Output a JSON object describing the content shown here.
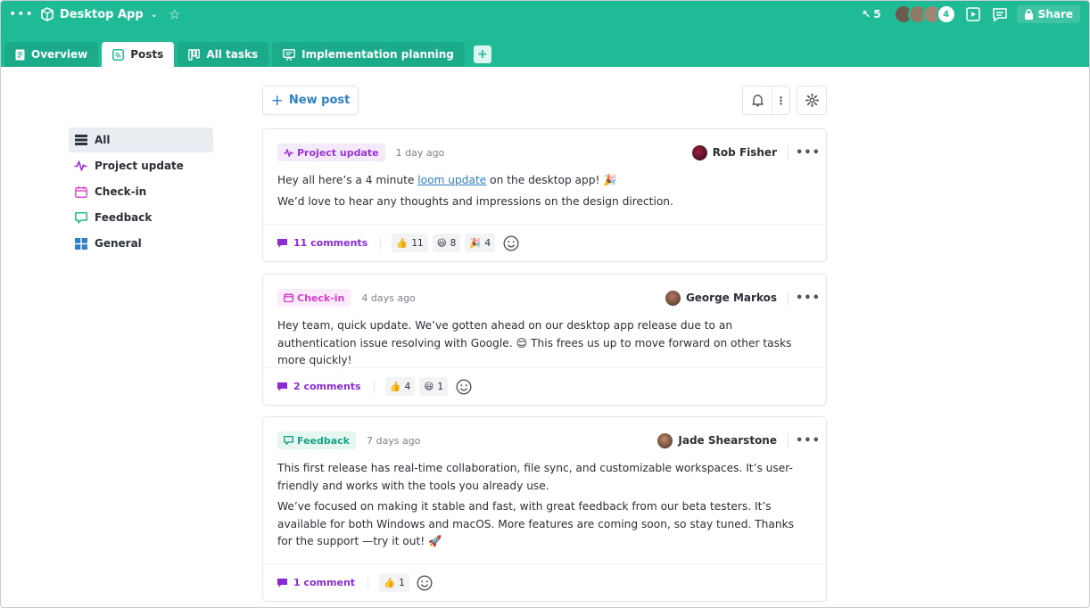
{
  "app": {
    "title": "Desktop App",
    "cursor_count": "5",
    "extra_members": "4",
    "share_label": "Share",
    "accent": "#1fba96"
  },
  "tabs": [
    {
      "label": "Overview",
      "icon": "document-icon"
    },
    {
      "label": "Posts",
      "icon": "feed-icon",
      "active": true
    },
    {
      "label": "All tasks",
      "icon": "kanban-icon"
    },
    {
      "label": "Implementation planning",
      "icon": "whiteboard-icon"
    }
  ],
  "sidebar": {
    "items": [
      {
        "label": "All",
        "icon": "list-icon",
        "color": "#2b3340",
        "active": true
      },
      {
        "label": "Project update",
        "icon": "activity-icon",
        "color": "#9b35d6"
      },
      {
        "label": "Check-in",
        "icon": "calendar-icon",
        "color": "#e04bd3"
      },
      {
        "label": "Feedback",
        "icon": "chat-icon",
        "color": "#1fba96"
      },
      {
        "label": "General",
        "icon": "grid-icon",
        "color": "#2f80c6"
      }
    ]
  },
  "toolbar": {
    "new_post_label": "New post"
  },
  "posts": [
    {
      "type": "Project update",
      "type_color": "#9b35d6",
      "type_bg": "#f5eafc",
      "time": "1 day ago",
      "author": "Rob Fisher",
      "body_1_pre": "Hey all here’s a 4 minute ",
      "body_1_link": "loom update",
      "body_1_post": " on the desktop app! 🎉",
      "body_2": "We’d love to hear any thoughts and impressions on the design direction.",
      "comments": "11 comments",
      "reactions": [
        {
          "emoji": "👍",
          "count": "11"
        },
        {
          "emoji": "😃",
          "count": "8"
        },
        {
          "emoji": "🎉",
          "count": "4"
        }
      ]
    },
    {
      "type": "Check-in",
      "type_color": "#d63fc8",
      "type_bg": "#fcebfa",
      "time": "4 days ago",
      "author": "George Markos",
      "body_1": "Hey team, quick update. We’ve gotten ahead on our desktop app release due to an authentication issue resolving with Google. 😌 This frees us up to move forward on other tasks more quickly!",
      "comments": "2 comments",
      "reactions": [
        {
          "emoji": "👍",
          "count": "4"
        },
        {
          "emoji": "😃",
          "count": "1"
        }
      ]
    },
    {
      "type": "Feedback",
      "type_color": "#17a383",
      "type_bg": "#e6f7f2",
      "time": "7 days ago",
      "author": "Jade Shearstone",
      "body_1": "This first release has real-time collaboration, file sync, and customizable workspaces. It’s user-friendly and works with the tools you already use.",
      "body_2": "We’ve focused on making it stable and fast, with great feedback from our beta testers. It’s available for both Windows and macOS. More features are coming soon, so stay tuned. Thanks for the support —try it out! 🚀",
      "comments": "1 comment",
      "reactions": [
        {
          "emoji": "👍",
          "count": "1"
        }
      ]
    }
  ]
}
